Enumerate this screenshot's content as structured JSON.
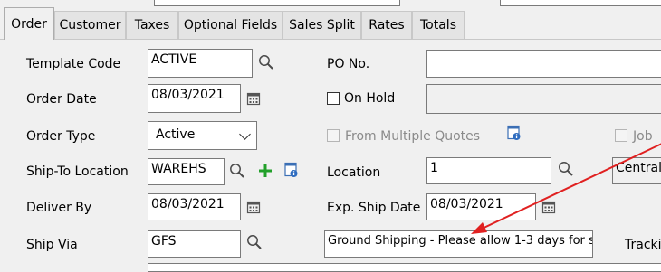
{
  "tabs": [
    {
      "label": "Order",
      "active": true
    },
    {
      "label": "Customer"
    },
    {
      "label": "Taxes"
    },
    {
      "label": "Optional Fields"
    },
    {
      "label": "Sales Split"
    },
    {
      "label": "Rates"
    },
    {
      "label": "Totals"
    }
  ],
  "left": {
    "template_code": {
      "label": "Template Code",
      "value": "ACTIVE"
    },
    "order_date": {
      "label": "Order Date",
      "value": "08/03/2021"
    },
    "order_type": {
      "label": "Order Type",
      "value": "Active"
    },
    "ship_to_location": {
      "label": "Ship-To Location",
      "value": "WAREHS"
    },
    "deliver_by": {
      "label": "Deliver By",
      "value": "08/03/2021"
    },
    "ship_via": {
      "label": "Ship Via",
      "value": "GFS"
    }
  },
  "right": {
    "po_no": {
      "label": "PO No.",
      "value": ""
    },
    "on_hold": {
      "label": "On Hold",
      "checked": false
    },
    "from_multiple_quotes": {
      "label": "From Multiple Quotes",
      "checked": false
    },
    "job_related_partial": "Job",
    "location": {
      "label": "Location",
      "value": "1",
      "name_partial": "Central"
    },
    "exp_ship_date": {
      "label": "Exp. Ship Date",
      "value": "08/03/2021"
    },
    "ship_via_description": "Ground Shipping - Please allow 1-3 days for s",
    "tracking_partial": "Tracki"
  },
  "annotation_color": "#e02020"
}
